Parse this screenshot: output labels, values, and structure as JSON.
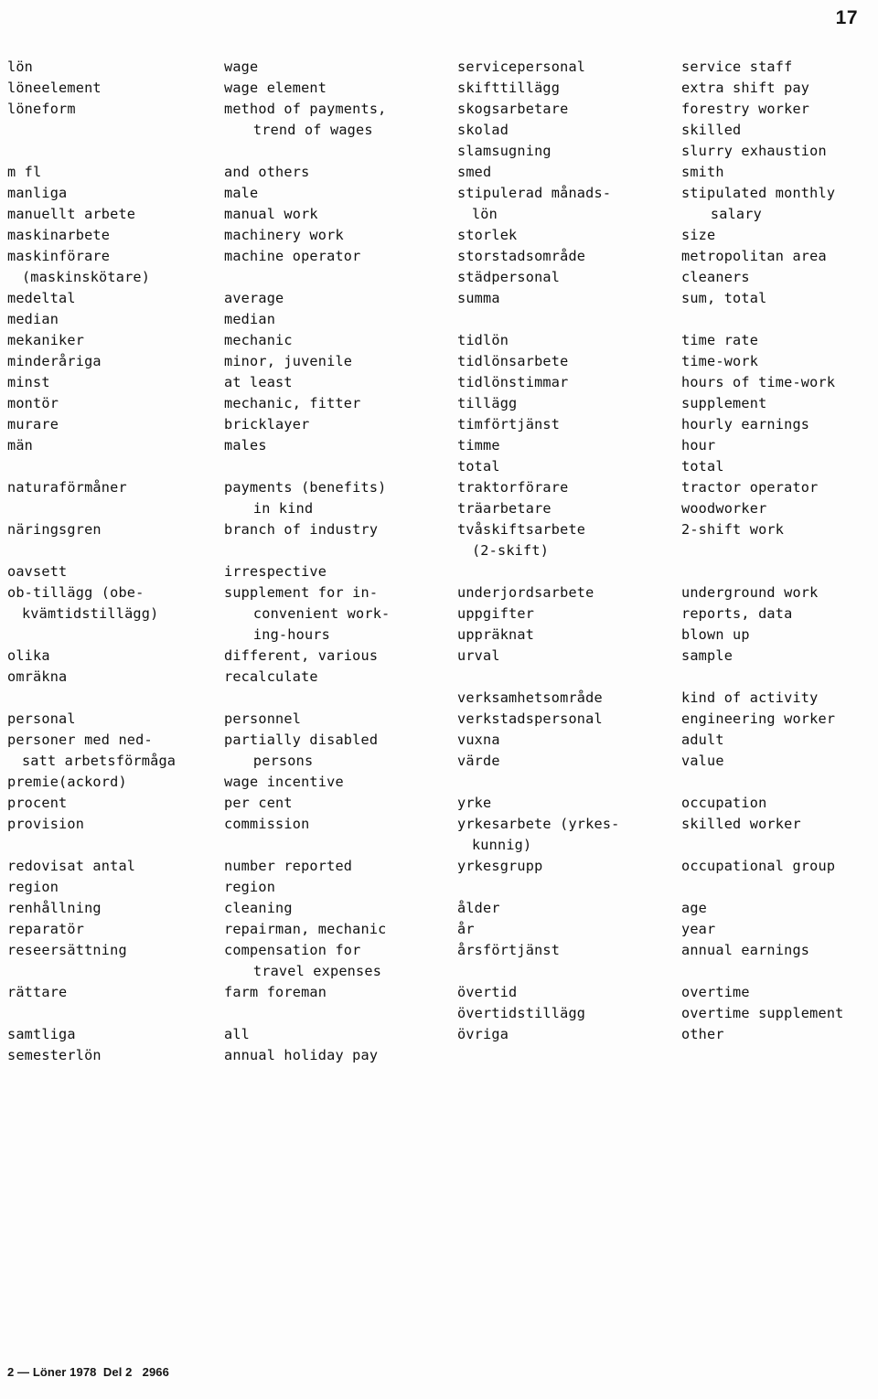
{
  "page": {
    "folio": "17",
    "footer": "2 — Löner 1978  Del 2   2966"
  },
  "glossary": {
    "left_column": [
      {
        "group_id": "l",
        "entries": [
          {
            "term": [
              "lön"
            ],
            "definition": [
              "wage"
            ]
          },
          {
            "term": [
              "löneelement"
            ],
            "definition": [
              "wage element"
            ]
          },
          {
            "term": [
              "löneform"
            ],
            "definition": [
              "method of payments,",
              "trend of wages"
            ]
          }
        ]
      },
      {
        "group_id": "m",
        "entries": [
          {
            "term": [
              "m fl"
            ],
            "definition": [
              "and others"
            ]
          },
          {
            "term": [
              "manliga"
            ],
            "definition": [
              "male"
            ]
          },
          {
            "term": [
              "manuellt arbete"
            ],
            "definition": [
              "manual work"
            ]
          },
          {
            "term": [
              "maskinarbete"
            ],
            "definition": [
              "machinery work"
            ]
          },
          {
            "term": [
              "maskinförare",
              "(maskinskötare)"
            ],
            "definition": [
              "machine operator"
            ]
          },
          {
            "term": [
              "medeltal"
            ],
            "definition": [
              "average"
            ]
          },
          {
            "term": [
              "median"
            ],
            "definition": [
              "median"
            ]
          },
          {
            "term": [
              "mekaniker"
            ],
            "definition": [
              "mechanic"
            ]
          },
          {
            "term": [
              "minderåriga"
            ],
            "definition": [
              "minor, juvenile"
            ]
          },
          {
            "term": [
              "minst"
            ],
            "definition": [
              "at least"
            ]
          },
          {
            "term": [
              "montör"
            ],
            "definition": [
              "mechanic, fitter"
            ]
          },
          {
            "term": [
              "murare"
            ],
            "definition": [
              "bricklayer"
            ]
          },
          {
            "term": [
              "män"
            ],
            "definition": [
              "males"
            ]
          }
        ]
      },
      {
        "group_id": "n",
        "entries": [
          {
            "term": [
              "naturaförmåner"
            ],
            "definition": [
              "payments (benefits)",
              "in kind"
            ]
          },
          {
            "term": [
              "näringsgren"
            ],
            "definition": [
              "branch of industry"
            ]
          }
        ]
      },
      {
        "group_id": "o",
        "entries": [
          {
            "term": [
              "oavsett"
            ],
            "definition": [
              "irrespective"
            ]
          },
          {
            "term": [
              "ob-tillägg (obe-",
              "kvämtidstillägg)"
            ],
            "definition": [
              "supplement for in-",
              "convenient work-",
              "ing-hours"
            ]
          },
          {
            "term": [
              "olika"
            ],
            "definition": [
              "different, various"
            ]
          },
          {
            "term": [
              "omräkna"
            ],
            "definition": [
              "recalculate"
            ]
          }
        ]
      },
      {
        "group_id": "p",
        "entries": [
          {
            "term": [
              "personal"
            ],
            "definition": [
              "personnel"
            ]
          },
          {
            "term": [
              "personer med ned-",
              "satt arbetsförmåga"
            ],
            "definition": [
              "partially disabled",
              "persons"
            ]
          },
          {
            "term": [
              "premie(ackord)"
            ],
            "definition": [
              "wage incentive"
            ]
          },
          {
            "term": [
              "procent"
            ],
            "definition": [
              "per cent"
            ]
          },
          {
            "term": [
              "provision"
            ],
            "definition": [
              "commission"
            ]
          }
        ]
      },
      {
        "group_id": "r",
        "entries": [
          {
            "term": [
              "redovisat antal"
            ],
            "definition": [
              "number reported"
            ]
          },
          {
            "term": [
              "region"
            ],
            "definition": [
              "region"
            ]
          },
          {
            "term": [
              "renhållning"
            ],
            "definition": [
              "cleaning"
            ]
          },
          {
            "term": [
              "reparatör"
            ],
            "definition": [
              "repairman, mechanic"
            ]
          },
          {
            "term": [
              "reseersättning"
            ],
            "definition": [
              "compensation for",
              "travel expenses"
            ]
          },
          {
            "term": [
              "rättare"
            ],
            "definition": [
              "farm foreman"
            ]
          }
        ]
      },
      {
        "group_id": "s",
        "entries": [
          {
            "term": [
              "samtliga"
            ],
            "definition": [
              "all"
            ]
          },
          {
            "term": [
              "semesterlön"
            ],
            "definition": [
              "annual holiday pay"
            ]
          }
        ]
      }
    ],
    "right_column": [
      {
        "group_id": "s2",
        "entries": [
          {
            "term": [
              "servicepersonal"
            ],
            "definition": [
              "service staff"
            ]
          },
          {
            "term": [
              "skifttillägg"
            ],
            "definition": [
              "extra shift pay"
            ]
          },
          {
            "term": [
              "skogsarbetare"
            ],
            "definition": [
              "forestry worker"
            ]
          },
          {
            "term": [
              "skolad"
            ],
            "definition": [
              "skilled"
            ]
          },
          {
            "term": [
              "slamsugning"
            ],
            "definition": [
              "slurry exhaustion"
            ]
          },
          {
            "term": [
              "smed"
            ],
            "definition": [
              "smith"
            ]
          },
          {
            "term": [
              "stipulerad månads-",
              "lön"
            ],
            "definition": [
              "stipulated monthly",
              "salary"
            ]
          },
          {
            "term": [
              "storlek"
            ],
            "definition": [
              "size"
            ]
          },
          {
            "term": [
              "storstadsområde"
            ],
            "definition": [
              "metropolitan area"
            ]
          },
          {
            "term": [
              "städpersonal"
            ],
            "definition": [
              "cleaners"
            ]
          },
          {
            "term": [
              "summa"
            ],
            "definition": [
              "sum, total"
            ]
          }
        ]
      },
      {
        "group_id": "t",
        "entries": [
          {
            "term": [
              "tidlön"
            ],
            "definition": [
              "time rate"
            ]
          },
          {
            "term": [
              "tidlönsarbete"
            ],
            "definition": [
              "time-work"
            ]
          },
          {
            "term": [
              "tidlönstimmar"
            ],
            "definition": [
              "hours of time-work"
            ]
          },
          {
            "term": [
              "tillägg"
            ],
            "definition": [
              "supplement"
            ]
          },
          {
            "term": [
              "timförtjänst"
            ],
            "definition": [
              "hourly earnings"
            ]
          },
          {
            "term": [
              "timme"
            ],
            "definition": [
              "hour"
            ]
          },
          {
            "term": [
              "total"
            ],
            "definition": [
              "total"
            ]
          },
          {
            "term": [
              "traktorförare"
            ],
            "definition": [
              "tractor operator"
            ]
          },
          {
            "term": [
              "träarbetare"
            ],
            "definition": [
              "woodworker"
            ]
          },
          {
            "term": [
              "tvåskiftsarbete",
              "(2-skift)"
            ],
            "definition": [
              "2-shift work"
            ]
          }
        ]
      },
      {
        "group_id": "u",
        "entries": [
          {
            "term": [
              "underjordsarbete"
            ],
            "definition": [
              "underground work"
            ]
          },
          {
            "term": [
              "uppgifter"
            ],
            "definition": [
              "reports, data"
            ]
          },
          {
            "term": [
              "uppräknat"
            ],
            "definition": [
              "blown up"
            ]
          },
          {
            "term": [
              "urval"
            ],
            "definition": [
              "sample"
            ]
          }
        ]
      },
      {
        "group_id": "v",
        "entries": [
          {
            "term": [
              "verksamhetsområde"
            ],
            "definition": [
              "kind of activity"
            ]
          },
          {
            "term": [
              "verkstadspersonal"
            ],
            "definition": [
              "engineering worker"
            ]
          },
          {
            "term": [
              "vuxna"
            ],
            "definition": [
              "adult"
            ]
          },
          {
            "term": [
              "värde"
            ],
            "definition": [
              "value"
            ]
          }
        ]
      },
      {
        "group_id": "y",
        "entries": [
          {
            "term": [
              "yrke"
            ],
            "definition": [
              "occupation"
            ]
          },
          {
            "term": [
              "yrkesarbete (yrkes-",
              "kunnig)"
            ],
            "definition": [
              "skilled worker"
            ]
          },
          {
            "term": [
              "yrkesgrupp"
            ],
            "definition": [
              "occupational group"
            ]
          }
        ]
      },
      {
        "group_id": "a-ring",
        "entries": [
          {
            "term": [
              "ålder"
            ],
            "definition": [
              "age"
            ]
          },
          {
            "term": [
              "år"
            ],
            "definition": [
              "year"
            ]
          },
          {
            "term": [
              "årsförtjänst"
            ],
            "definition": [
              "annual earnings"
            ]
          }
        ]
      },
      {
        "group_id": "o-umlaut",
        "entries": [
          {
            "term": [
              "övertid"
            ],
            "definition": [
              "overtime"
            ]
          },
          {
            "term": [
              "övertidstillägg"
            ],
            "definition": [
              "overtime supplement"
            ]
          },
          {
            "term": [
              "övriga"
            ],
            "definition": [
              "other"
            ]
          }
        ]
      }
    ]
  }
}
